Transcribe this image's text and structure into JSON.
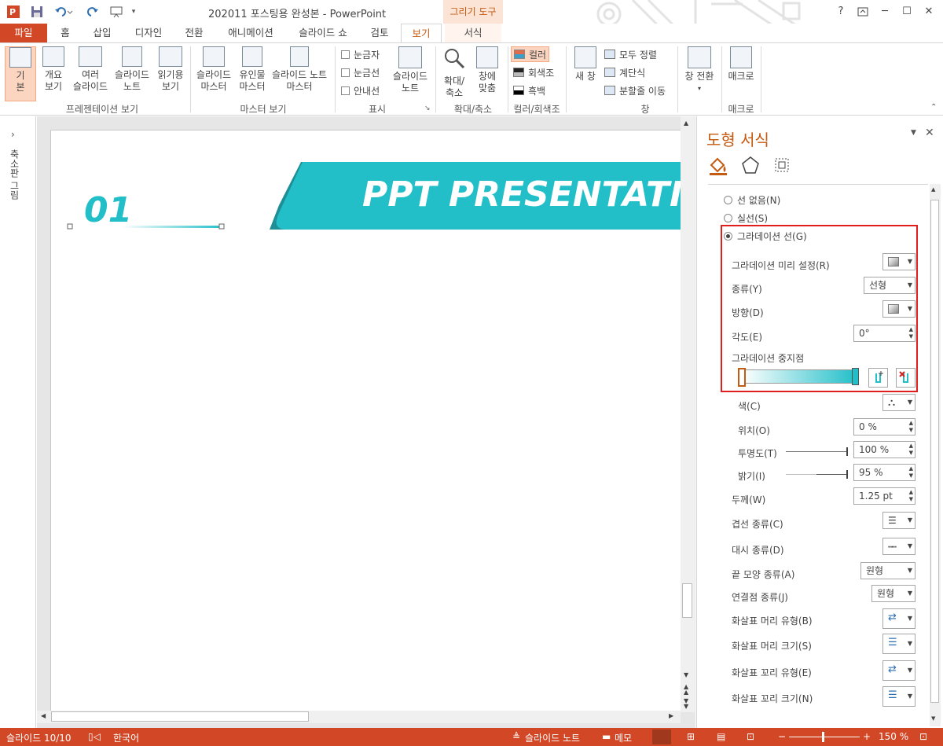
{
  "title_bar": {
    "title": "202011 포스팅용 완성본 - PowerPoint",
    "context_tab": "그리기 도구",
    "help": "?",
    "minimize": "─",
    "maximize": "☐",
    "close": "✕"
  },
  "tabs": {
    "file": "파일",
    "home": "홈",
    "insert": "삽입",
    "design": "디자인",
    "transitions": "전환",
    "animations": "애니메이션",
    "slideshow": "슬라이드 쇼",
    "review": "검토",
    "view": "보기",
    "format": "서식"
  },
  "ribbon": {
    "presentation_views": {
      "normal": "기\n본",
      "outline": "개요\n보기",
      "sorter": "여러\n슬라이드",
      "notes": "슬라이드\n노트",
      "reading": "읽기용\n보기",
      "label": "프레젠테이션 보기"
    },
    "master_views": {
      "slide_master": "슬라이드\n마스터",
      "handout_master": "유인물\n마스터",
      "notes_master": "슬라이드 노트\n마스터",
      "label": "마스터 보기"
    },
    "show": {
      "ruler": "눈금자",
      "gridlines": "눈금선",
      "guides": "안내선",
      "notes": "슬라이드\n노트",
      "label": "표시"
    },
    "zoom": {
      "zoom": "확대/\n축소",
      "fit": "창에\n맞춤",
      "label": "확대/축소"
    },
    "color": {
      "color": "컬러",
      "grayscale": "회색조",
      "bw": "흑백",
      "label": "컬러/회색조"
    },
    "window": {
      "new_window": "새 창",
      "arrange_all": "모두 정렬",
      "cascade": "계단식",
      "move_split": "분할줄 이동",
      "switch": "창 전환",
      "label": "창"
    },
    "macros": {
      "macros": "매크로",
      "label": "매크로"
    }
  },
  "thumbnails": {
    "label": "축소판 그림"
  },
  "slide": {
    "number": "01",
    "banner": "PPT PRESENTATION"
  },
  "pane": {
    "title": "도형 서식",
    "no_line": "선 없음(N)",
    "solid_line": "실선(S)",
    "gradient_line": "그라데이션 선(G)",
    "preset_label": "그라데이션 미리 설정(R)",
    "type_label": "종류(Y)",
    "type_value": "선형",
    "direction_label": "방향(D)",
    "angle_label": "각도(E)",
    "angle_value": "0°",
    "stops_label": "그라데이션 중지점",
    "color_label": "색(C)",
    "position_label": "위치(O)",
    "position_value": "0 %",
    "transparency_label": "투명도(T)",
    "transparency_value": "100 %",
    "brightness_label": "밝기(I)",
    "brightness_value": "95 %",
    "width_label": "두께(W)",
    "width_value": "1.25 pt",
    "compound_label": "겹선 종류(C)",
    "dash_label": "대시 종류(D)",
    "cap_label": "끝 모양 종류(A)",
    "cap_value": "원형",
    "join_label": "연결점 종류(J)",
    "join_value": "원형",
    "begin_arrow_type": "화살표 머리 유형(B)",
    "begin_arrow_size": "화살표 머리 크기(S)",
    "end_arrow_type": "화살표 꼬리 유형(E)",
    "end_arrow_size": "화살표 꼬리 크기(N)"
  },
  "status": {
    "slide": "슬라이드 10/10",
    "language": "한국어",
    "notes": "슬라이드 노트",
    "comments": "메모",
    "zoom": "150 %"
  },
  "colors": {
    "accent": "#d24726",
    "teal": "#22bfc9"
  }
}
